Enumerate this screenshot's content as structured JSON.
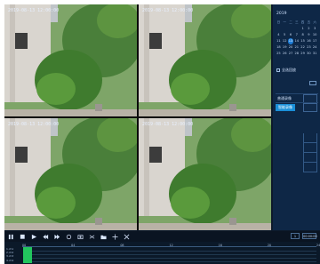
{
  "playback": {
    "tiles": [
      {
        "id": "ch1",
        "timestamp": "2019-08-13 12:00:00"
      },
      {
        "id": "ch2",
        "timestamp": "2019-08-13 12:00:00"
      },
      {
        "id": "ch3",
        "timestamp": "2019-08-13 12:00:00"
      },
      {
        "id": "ch4",
        "timestamp": "2019-08-13 12:00:00"
      }
    ]
  },
  "calendar": {
    "month_label": "2019",
    "weekdays": [
      "日",
      "一",
      "二",
      "三",
      "四",
      "五",
      "六"
    ],
    "weeks": [
      [
        "",
        "",
        "",
        "",
        "1",
        "2",
        "3"
      ],
      [
        "4",
        "5",
        "6",
        "7",
        "8",
        "9",
        "10"
      ],
      [
        "11",
        "12",
        "13",
        "14",
        "15",
        "16",
        "17"
      ],
      [
        "18",
        "19",
        "20",
        "21",
        "22",
        "23",
        "24"
      ],
      [
        "25",
        "26",
        "27",
        "28",
        "29",
        "30",
        "31"
      ]
    ],
    "selected_day": "13"
  },
  "sidebar": {
    "select_all_label": "全选回放",
    "channels": [
      {
        "label": "普通录像",
        "active": false
      },
      {
        "label": "智能录像",
        "active": true
      }
    ]
  },
  "toolbar": {
    "icons": [
      "pause-icon",
      "stop-icon",
      "play-icon",
      "rewind-icon",
      "fast-forward-icon",
      "slow-icon",
      "snapshot-icon",
      "clip-icon",
      "folder-icon",
      "zoom-icon",
      "close-icon"
    ],
    "right_fields": [
      "1",
      "00:00:00"
    ]
  },
  "timeline": {
    "ticks": [
      "00",
      "04",
      "08",
      "12",
      "16",
      "20",
      "24"
    ],
    "row_labels": [
      "1.ch1",
      "2.ch2",
      "3.ch3",
      "4.ch4"
    ]
  },
  "colors": {
    "accent": "#1a8fd8",
    "recording": "#22c55e",
    "panel_bg": "#0e2746",
    "app_bg": "#0d1a2b"
  }
}
